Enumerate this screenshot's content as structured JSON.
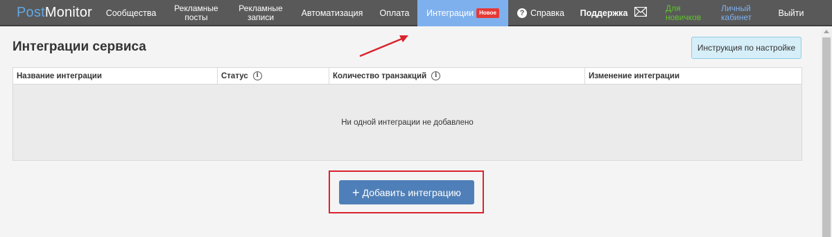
{
  "nav": {
    "logo": {
      "part1": "Post",
      "part2": "Monitor"
    },
    "items": [
      {
        "label": "Сообщества"
      },
      {
        "label": "Рекламные посты"
      },
      {
        "label": "Рекламные записи"
      },
      {
        "label": "Автоматизация"
      },
      {
        "label": "Оплата"
      },
      {
        "label": "Интеграции",
        "badge": "Новое"
      },
      {
        "label": "Справка"
      },
      {
        "label": "Поддержка"
      },
      {
        "label": "Для новичков"
      },
      {
        "label": "Личный кабинет"
      },
      {
        "label": "Выйти"
      }
    ],
    "colors": {
      "bar": "#595959",
      "active": "#7fb0ee",
      "badge": "#e53935",
      "green": "#5ec62a"
    }
  },
  "page": {
    "title": "Интеграции сервиса",
    "instruction_button": "Инструкция по настройке",
    "table": {
      "columns": [
        "Название интеграции",
        "Статус",
        "Количество транзакций",
        "Изменение интеграции"
      ],
      "empty_message": "Ни одной интеграции не добавлено"
    },
    "add_button": "Добавить интеграцию",
    "add_button_icon": "plus-icon"
  }
}
